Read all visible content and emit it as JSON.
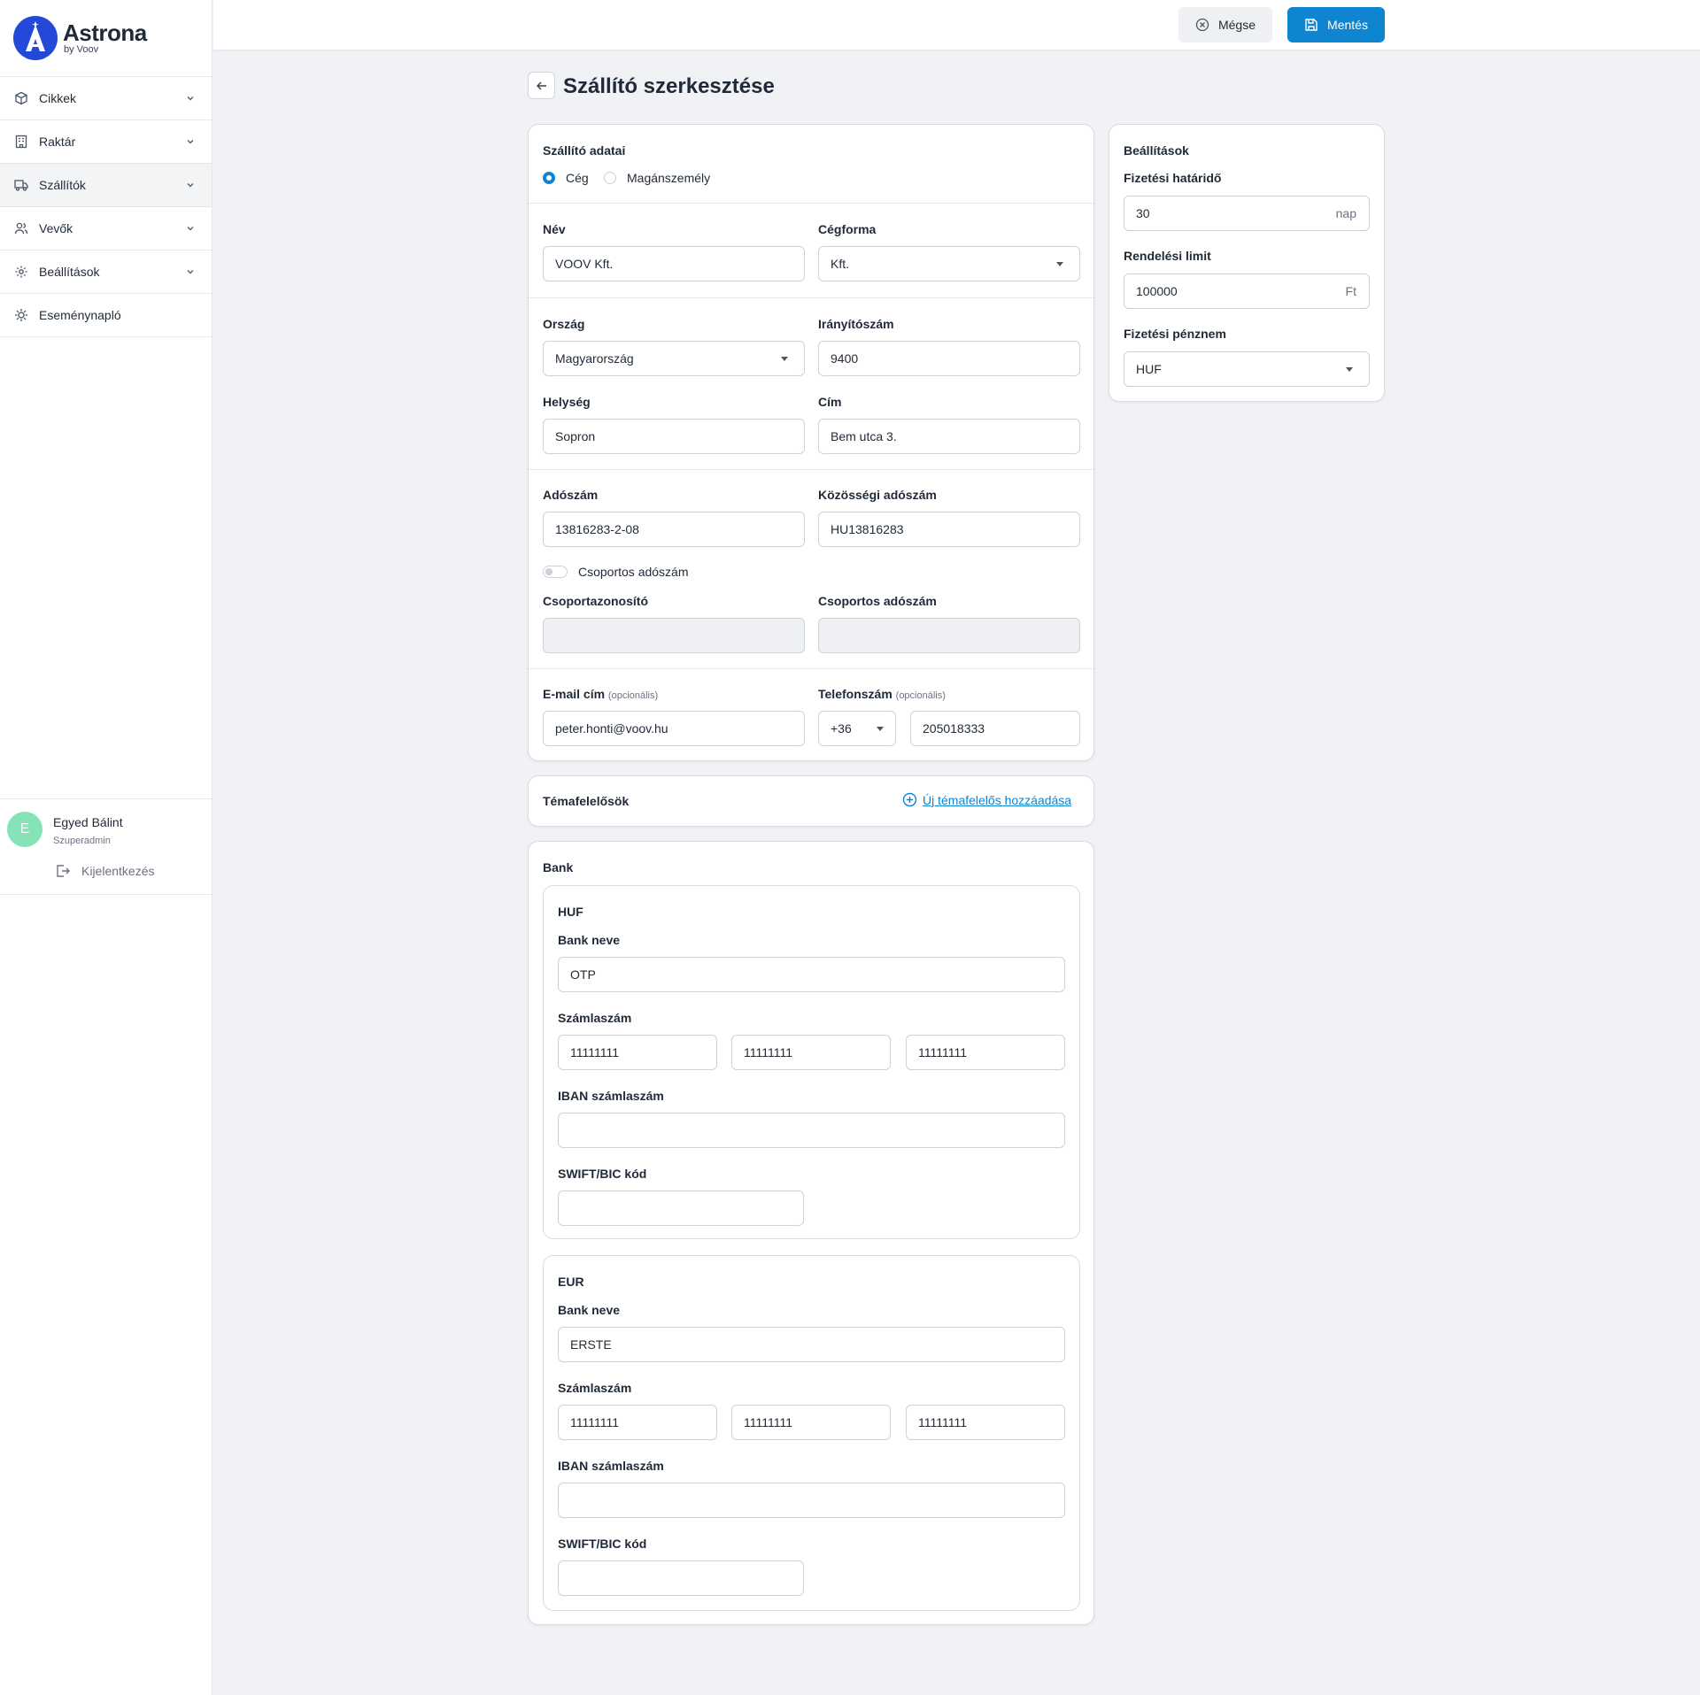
{
  "brand": {
    "name": "Astrona",
    "sub": "by Voov"
  },
  "sidebar": {
    "items": [
      {
        "label": "Cikkek"
      },
      {
        "label": "Raktár"
      },
      {
        "label": "Szállítók"
      },
      {
        "label": "Vevők"
      },
      {
        "label": "Beállítások"
      },
      {
        "label": "Eseménynapló"
      }
    ],
    "user": {
      "initial": "E",
      "name": "Egyed Bálint",
      "role": "Szuperadmin",
      "logout": "Kijelentkezés"
    }
  },
  "toolbar": {
    "cancel_label": "Mégse",
    "save_label": "Mentés"
  },
  "page": {
    "title": "Szállító szerkesztése"
  },
  "supplier": {
    "section_title": "Szállító adatai",
    "type_company": "Cég",
    "type_person": "Magánszemély",
    "name_label": "Név",
    "name_value": "VOOV Kft.",
    "form_label": "Cégforma",
    "form_value": "Kft.",
    "country_label": "Ország",
    "country_value": "Magyarország",
    "zip_label": "Irányítószám",
    "zip_value": "9400",
    "city_label": "Helység",
    "city_value": "Sopron",
    "address_label": "Cím",
    "address_value": "Bem utca 3.",
    "tax_label": "Adószám",
    "tax_value": "13816283-2-08",
    "eu_tax_label": "Közösségi adószám",
    "eu_tax_value": "HU13816283",
    "group_toggle_label": "Csoportos adószám",
    "group_id_label": "Csoportazonosító",
    "group_tax_label": "Csoportos adószám",
    "email_label": "E-mail cím",
    "email_optional": "(opcionális)",
    "email_value": "peter.honti@voov.hu",
    "phone_label": "Telefonszám",
    "phone_optional": "(opcionális)",
    "phone_prefix": "+36",
    "phone_value": "205018333"
  },
  "contacts": {
    "title": "Témafelelősök",
    "add_label": "Új témafelelős hozzáadása"
  },
  "bank": {
    "title": "Bank",
    "accounts": [
      {
        "currency": "HUF",
        "bank_name_label": "Bank neve",
        "bank_name_value": "OTP",
        "account_label": "Számlaszám",
        "account_parts": [
          "11111111",
          "11111111",
          "11111111"
        ],
        "iban_label": "IBAN számlaszám",
        "iban_value": "",
        "swift_label": "SWIFT/BIC kód",
        "swift_value": ""
      },
      {
        "currency": "EUR",
        "bank_name_label": "Bank neve",
        "bank_name_value": "ERSTE",
        "account_label": "Számlaszám",
        "account_parts": [
          "11111111",
          "11111111",
          "11111111"
        ],
        "iban_label": "IBAN számlaszám",
        "iban_value": "",
        "swift_label": "SWIFT/BIC kód",
        "swift_value": ""
      }
    ]
  },
  "settings": {
    "title": "Beállítások",
    "deadline_label": "Fizetési határidő",
    "deadline_value": "30",
    "deadline_unit": "nap",
    "limit_label": "Rendelési limit",
    "limit_value": "100000",
    "limit_unit": "Ft",
    "currency_label": "Fizetési pénznem",
    "currency_value": "HUF"
  },
  "colors": {
    "primary": "#0f84d1",
    "brand": "#2448d8",
    "avatar": "#86e3b8",
    "background": "#f0f2f5"
  }
}
